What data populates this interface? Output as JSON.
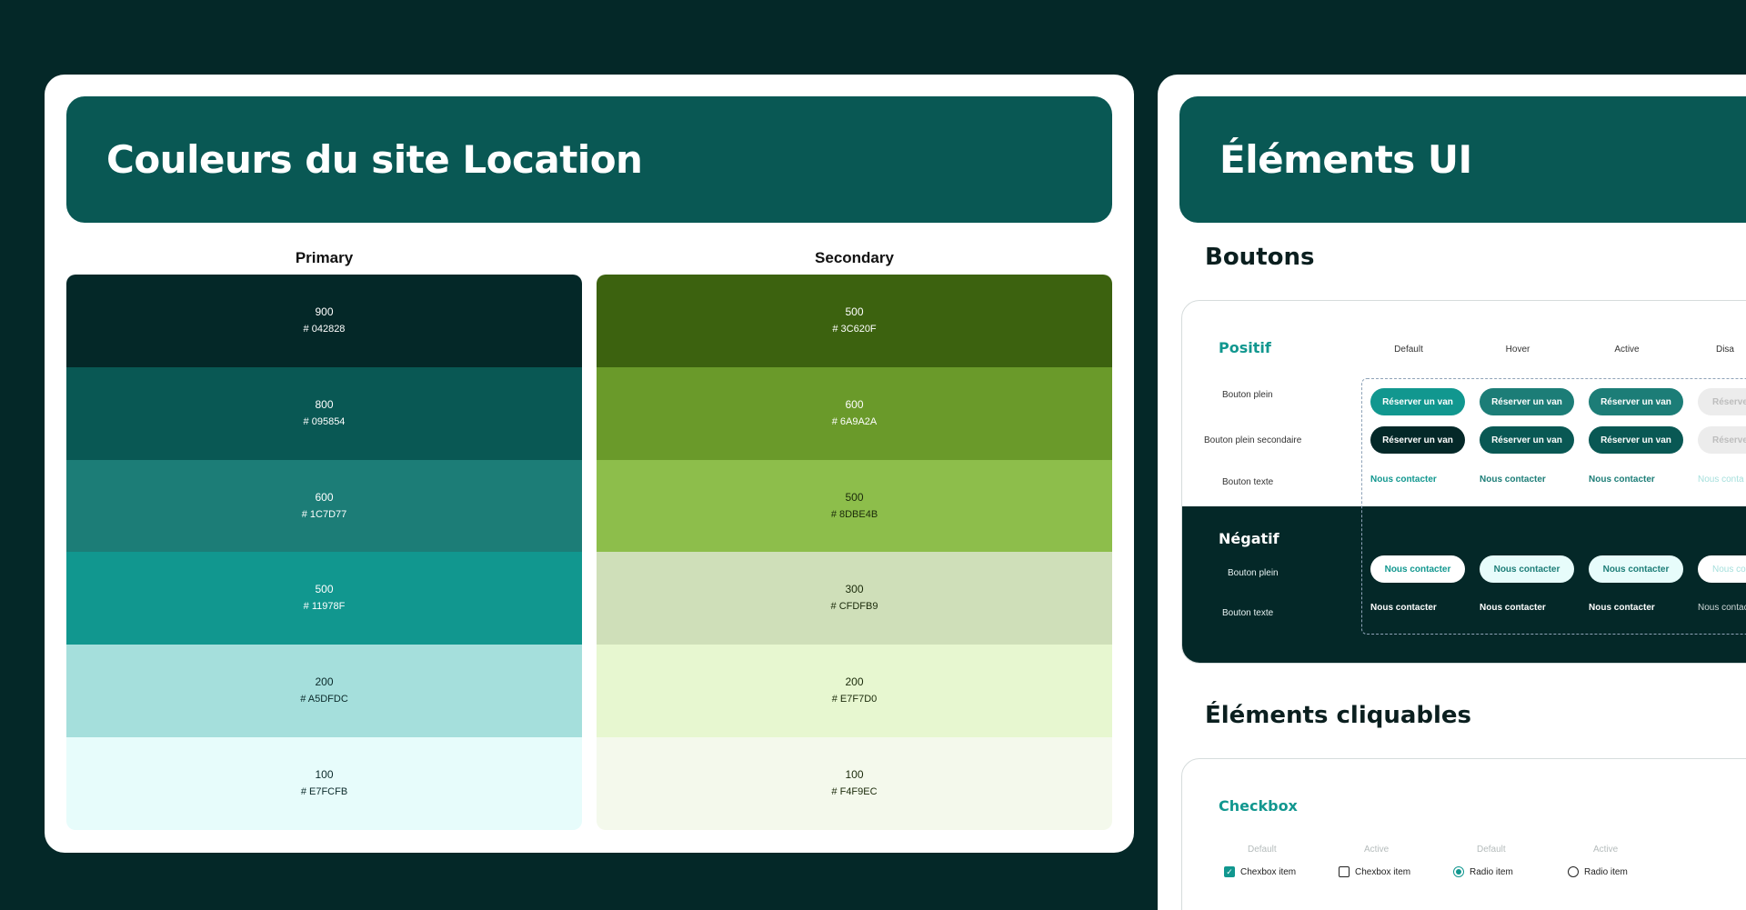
{
  "left": {
    "title": "Couleurs du site Location",
    "primary": {
      "title": "Primary",
      "swatches": [
        {
          "level": "900",
          "hex": "# 042828",
          "color": "#042828",
          "text": "#ffffff"
        },
        {
          "level": "800",
          "hex": "# 095854",
          "color": "#095854",
          "text": "#ffffff"
        },
        {
          "level": "600",
          "hex": "# 1C7D77",
          "color": "#1C7D77",
          "text": "#ffffff"
        },
        {
          "level": "500",
          "hex": "# 11978F",
          "color": "#11978F",
          "text": "#ffffff"
        },
        {
          "level": "200",
          "hex": "# A5DFDC",
          "color": "#A5DFDC",
          "text": "#0b2a2a"
        },
        {
          "level": "100",
          "hex": "# E7FCFB",
          "color": "#E7FCFB",
          "text": "#0b2a2a"
        }
      ]
    },
    "secondary": {
      "title": "Secondary",
      "swatches": [
        {
          "level": "500",
          "hex": "# 3C620F",
          "color": "#3C620F",
          "text": "#ffffff"
        },
        {
          "level": "600",
          "hex": "# 6A9A2A",
          "color": "#6A9A2A",
          "text": "#ffffff"
        },
        {
          "level": "500",
          "hex": "# 8DBE4B",
          "color": "#8DBE4B",
          "text": "#1a2a0a"
        },
        {
          "level": "300",
          "hex": "# CFDFB9",
          "color": "#CFDFB9",
          "text": "#1a2a0a"
        },
        {
          "level": "200",
          "hex": "# E7F7D0",
          "color": "#E7F7D0",
          "text": "#1a2a0a"
        },
        {
          "level": "100",
          "hex": "# F4F9EC",
          "color": "#F4F9EC",
          "text": "#1a2a0a"
        }
      ]
    }
  },
  "right": {
    "title": "Éléments UI",
    "buttons_title": "Boutons",
    "states": [
      "Default",
      "Hover",
      "Active",
      "Disa"
    ],
    "positif": {
      "label": "Positif",
      "rows": [
        "Bouton plein",
        "Bouton plein secondaire",
        "Bouton texte"
      ],
      "primary_label": "Réserver un van",
      "disabled_primary_label": "Réserve",
      "text_label": "Nous contacter",
      "disabled_text_label": "Nous conta"
    },
    "negatif": {
      "label": "Négatif",
      "rows": [
        "Bouton plein",
        "Bouton texte"
      ],
      "btn_label": "Nous contacter",
      "disabled_btn_label": "Nous co",
      "text_label": "Nous contacter",
      "disabled_text_label": "Nous contac"
    },
    "clickable_title": "Éléments cliquables",
    "checkbox": {
      "title": "Checkbox",
      "states": [
        "Default",
        "Active",
        "Default",
        "Active"
      ],
      "items": [
        "Chexbox item",
        "Chexbox item",
        "Radio item",
        "Radio item"
      ]
    }
  },
  "colors": {
    "background": "#042828",
    "banner": "#095854",
    "accent": "#11978f"
  }
}
